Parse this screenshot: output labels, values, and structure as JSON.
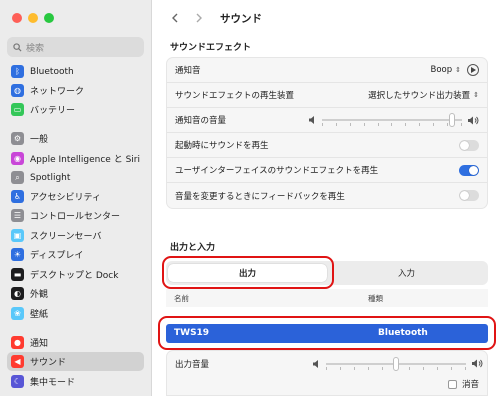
{
  "window": {
    "title": "サウンド"
  },
  "search": {
    "placeholder": "検索"
  },
  "sidebar": {
    "items": [
      {
        "label": "Bluetooth",
        "icon": "bluetooth-icon",
        "color": "#2f6fe0"
      },
      {
        "label": "ネットワーク",
        "icon": "globe-icon",
        "color": "#2f6fe0"
      },
      {
        "label": "バッテリー",
        "icon": "battery-icon",
        "color": "#34c759"
      },
      {
        "label": "一般",
        "icon": "gear-icon",
        "color": "#8e8e93"
      },
      {
        "label": "Apple Intelligence と Siri",
        "icon": "siri-icon",
        "color": "#c946d8"
      },
      {
        "label": "Spotlight",
        "icon": "search-icon",
        "color": "#8e8e93"
      },
      {
        "label": "アクセシビリティ",
        "icon": "accessibility-icon",
        "color": "#2f6fe0"
      },
      {
        "label": "コントロールセンター",
        "icon": "control-center-icon",
        "color": "#8e8e93"
      },
      {
        "label": "スクリーンセーバ",
        "icon": "screensaver-icon",
        "color": "#5ac8fa"
      },
      {
        "label": "ディスプレイ",
        "icon": "display-icon",
        "color": "#2f6fe0"
      },
      {
        "label": "デスクトップと Dock",
        "icon": "dock-icon",
        "color": "#1c1c1e"
      },
      {
        "label": "外観",
        "icon": "appearance-icon",
        "color": "#1c1c1e"
      },
      {
        "label": "壁紙",
        "icon": "wallpaper-icon",
        "color": "#5ac8fa"
      },
      {
        "label": "通知",
        "icon": "notification-icon",
        "color": "#ff3b30"
      },
      {
        "label": "サウンド",
        "icon": "speaker-icon",
        "color": "#ff3b30"
      },
      {
        "label": "集中モード",
        "icon": "moon-icon",
        "color": "#5856d6"
      }
    ]
  },
  "sound_effects": {
    "title": "サウンドエフェクト",
    "alert_sound_label": "通知音",
    "alert_sound_value": "Boop",
    "output_device_label": "サウンドエフェクトの再生装置",
    "output_device_value": "選択したサウンド出力装置",
    "alert_volume_label": "通知音の音量",
    "alert_volume_level": 0.95,
    "startup_label": "起動時にサウンドを再生",
    "startup_on": false,
    "ui_effects_label": "ユーザインターフェイスのサウンドエフェクトを再生",
    "ui_effects_on": true,
    "feedback_label": "音量を変更するときにフィードバックを再生",
    "feedback_on": false
  },
  "output_input": {
    "title": "出力と入力",
    "tab_output": "出力",
    "tab_input": "入力",
    "col_name": "名前",
    "col_type": "種類",
    "device_name": "TWS19",
    "device_type": "Bluetooth",
    "output_volume_label": "出力音量",
    "output_volume_level": 0.5,
    "mute_label": "消音"
  },
  "colors": {
    "accent": "#2b62d9",
    "highlight": "#e01414"
  }
}
